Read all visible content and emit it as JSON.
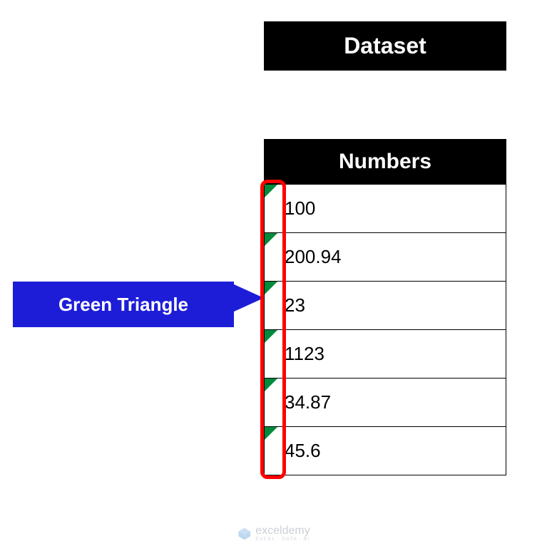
{
  "title": "Dataset",
  "header": "Numbers",
  "rows": [
    "100",
    "200.94",
    "23",
    "1123",
    "34.87",
    "45.6"
  ],
  "callout": "Green Triangle",
  "watermark": {
    "main": "exceldemy",
    "sub": "EXCEL · DATA · BI"
  },
  "colors": {
    "triangle": "#008a3b",
    "highlight": "#ff0000",
    "callout": "#1d1dd8"
  }
}
